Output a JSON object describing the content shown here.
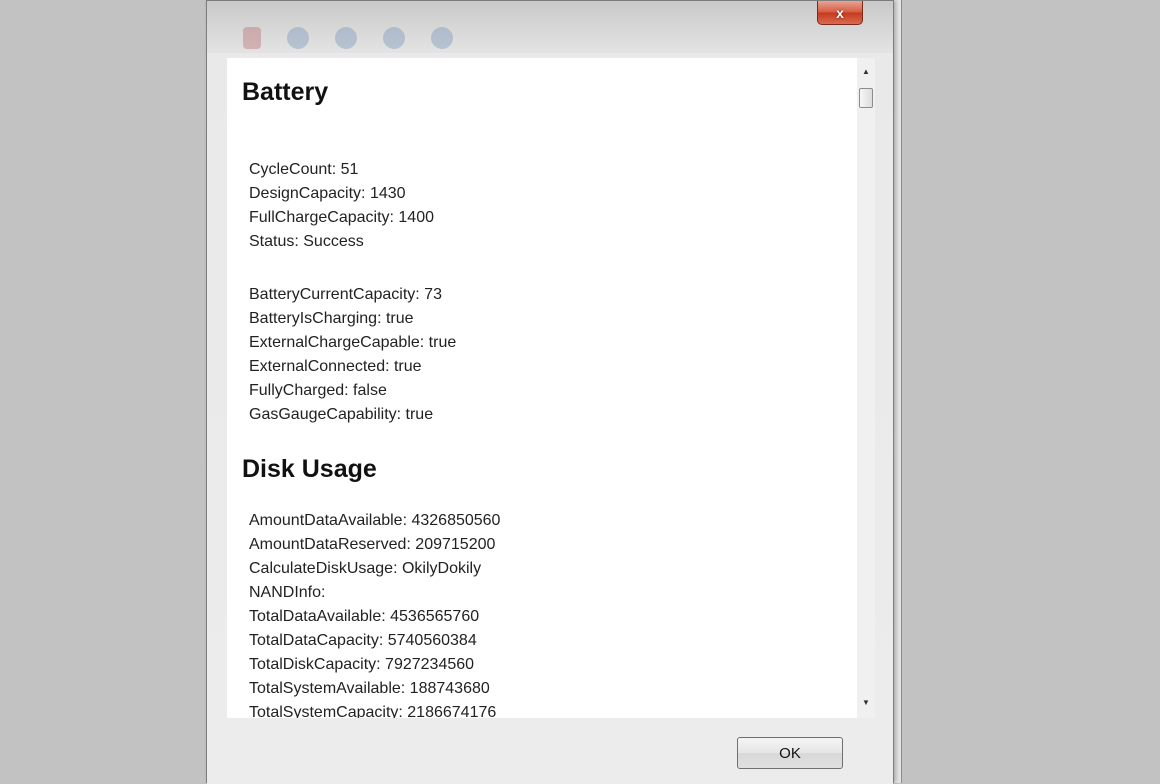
{
  "window": {
    "close_label": "x"
  },
  "battery": {
    "heading": "Battery",
    "group1": [
      "CycleCount: 51",
      "DesignCapacity: 1430",
      "FullChargeCapacity: 1400",
      "Status: Success"
    ],
    "group2": [
      "BatteryCurrentCapacity: 73",
      "BatteryIsCharging: true",
      "ExternalChargeCapable: true",
      "ExternalConnected: true",
      "FullyCharged: false",
      "GasGaugeCapability: true"
    ]
  },
  "disk": {
    "heading": "Disk Usage",
    "items": [
      "AmountDataAvailable: 4326850560",
      "AmountDataReserved: 209715200",
      "CalculateDiskUsage: OkilyDokily",
      "NANDInfo:",
      "TotalDataAvailable: 4536565760",
      "TotalDataCapacity: 5740560384",
      "TotalDiskCapacity: 7927234560",
      "TotalSystemAvailable: 188743680",
      "TotalSystemCapacity: 2186674176"
    ]
  },
  "footer": {
    "ok_label": "OK"
  },
  "icons": {
    "scroll_up": "triangle-up",
    "scroll_down": "triangle-down"
  }
}
